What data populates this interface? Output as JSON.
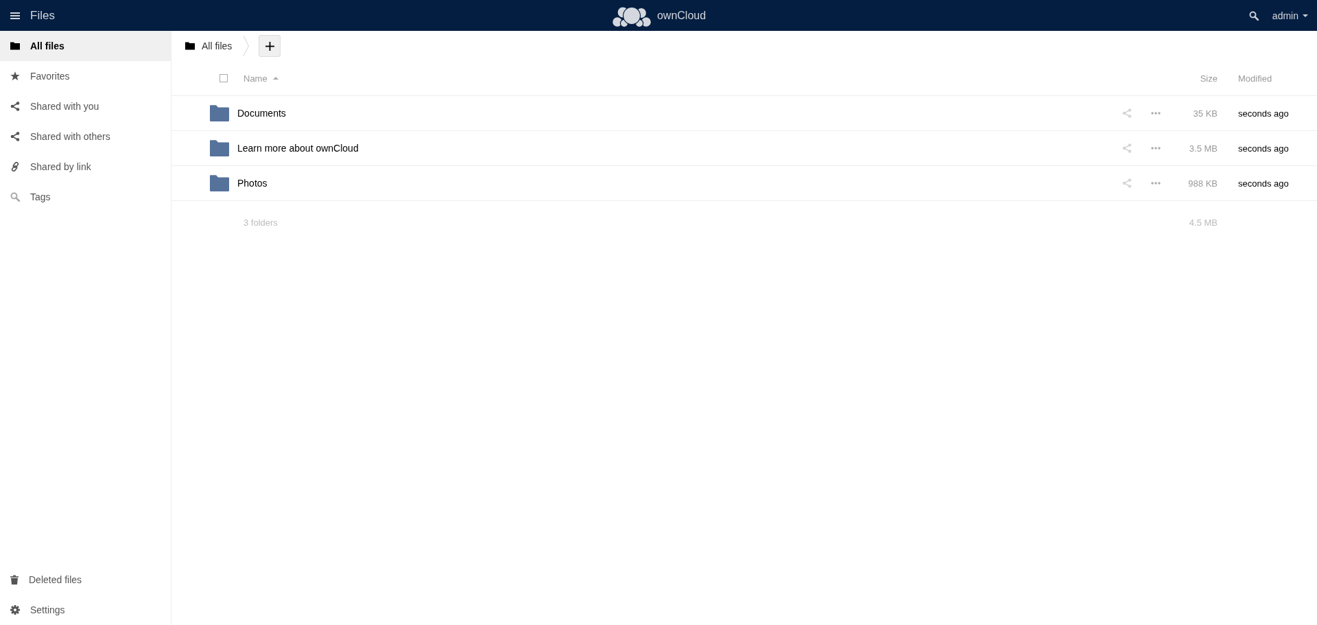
{
  "header": {
    "title": "Files",
    "brand": "ownCloud",
    "user": "admin"
  },
  "sidebar": {
    "items": [
      {
        "label": "All files",
        "kind": "all",
        "selected": true
      },
      {
        "label": "Favorites",
        "kind": "favorites",
        "selected": false
      },
      {
        "label": "Shared with you",
        "kind": "shared",
        "selected": false
      },
      {
        "label": "Shared with others",
        "kind": "shared",
        "selected": false
      },
      {
        "label": "Shared by link",
        "kind": "link",
        "selected": false
      },
      {
        "label": "Tags",
        "kind": "tags",
        "selected": false
      }
    ],
    "footer_items": [
      {
        "label": "Deleted files",
        "kind": "trash"
      },
      {
        "label": "Settings",
        "kind": "settings"
      }
    ]
  },
  "breadcrumb": {
    "items": [
      {
        "label": "All files"
      }
    ]
  },
  "table": {
    "select_all": {
      "checked": false
    },
    "columns": [
      {
        "label": "Name",
        "sorted": true
      },
      {
        "label": "Size",
        "sorted": false
      },
      {
        "label": "Modified",
        "sorted": false
      }
    ],
    "rows": [
      {
        "name": "Documents",
        "size": "35 KB",
        "modified": "seconds ago"
      },
      {
        "name": "Learn more about ownCloud",
        "size": "3.5 MB",
        "modified": "seconds ago"
      },
      {
        "name": "Photos",
        "size": "988 KB",
        "modified": "seconds ago"
      }
    ],
    "summary": {
      "count": "3 folders",
      "size": "4.5 MB"
    }
  }
}
